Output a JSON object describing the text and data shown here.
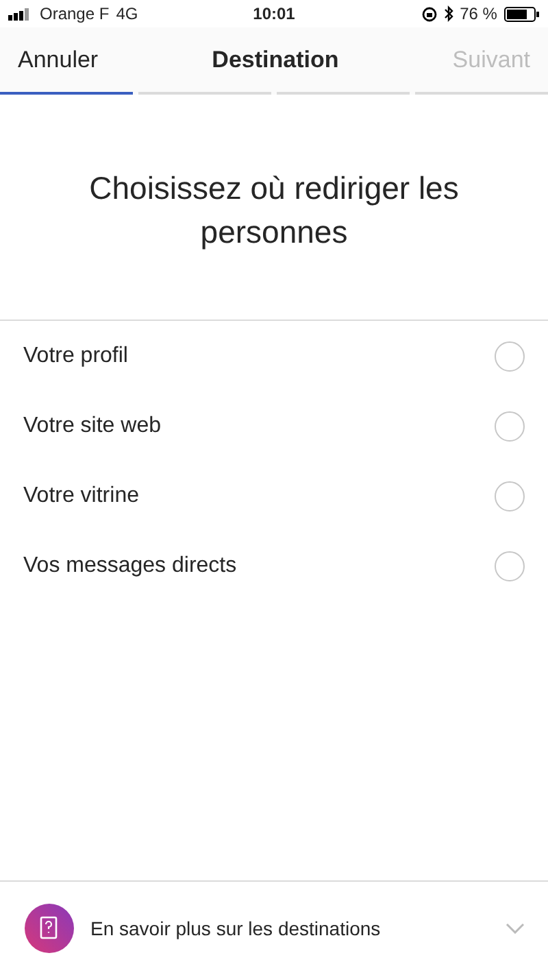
{
  "status_bar": {
    "carrier": "Orange F",
    "network": "4G",
    "time": "10:01",
    "battery": "76 %"
  },
  "nav": {
    "cancel": "Annuler",
    "title": "Destination",
    "next": "Suivant",
    "next_disabled": true
  },
  "steps": [
    {
      "selected": true
    },
    {
      "selected": false
    },
    {
      "selected": false
    },
    {
      "selected": false
    }
  ],
  "heading": "Choisissez où rediriger les personnes",
  "options": [
    {
      "label": "Votre profil",
      "selected": false
    },
    {
      "label": "Votre site web",
      "selected": false
    },
    {
      "label": "Votre vitrine",
      "selected": false
    },
    {
      "label": "Vos messages directs",
      "selected": false
    }
  ],
  "footer": {
    "text": "En savoir plus sur les destinations",
    "expanded": false
  }
}
